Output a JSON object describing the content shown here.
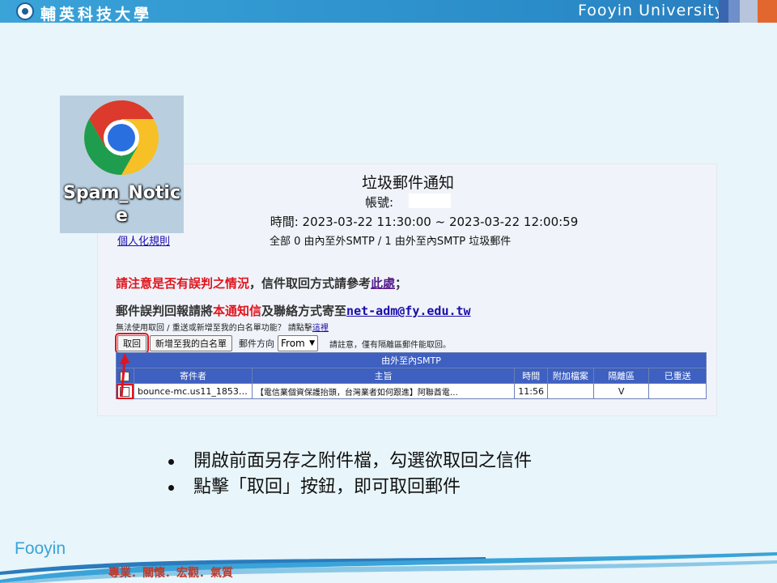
{
  "header": {
    "cn_name": "輔英科技大學",
    "en_name": "Fooyin University"
  },
  "chrome_tile": {
    "label_line1": "Spam_Notic",
    "label_line2": "e",
    "icon": "chrome-icon"
  },
  "mail": {
    "title": "垃圾郵件通知",
    "account_label": "帳號:",
    "time_line": "時間: 2023-03-22 11:30:00 ~ 2023-03-22 12:00:59",
    "rule_link": "個人化規則",
    "summary": "全部  0 由內至外SMTP / 1 由外至內SMTP  垃圾郵件",
    "notice1_red": "請注意是否有誤判之情況",
    "notice1_mid": "，信件取回方式請參考",
    "notice1_link": "此處",
    "notice1_end": "；",
    "notice2_start": "郵件誤判回報請將",
    "notice2_red": "本通知信",
    "notice2_mid": "及聯絡方式寄至",
    "notice2_email": "net-adm@fy.edu.tw",
    "notice3_text": "無法使用取回 / 重送或新增至我的白名單功能？ 請點擊",
    "notice3_link": "這裡",
    "toolbar": {
      "retrieve_button": "取回",
      "whitelist_button": "新增至我的白名單",
      "direction_label": "郵件方向",
      "direction_value": "From",
      "note": "請註意，僅有隔離區郵件能取回。"
    },
    "table": {
      "group_header": "由外至內SMTP",
      "columns": [
        "寄件者",
        "主旨",
        "時間",
        "附加檔案",
        "隔離區",
        "已重送"
      ],
      "rows": [
        {
          "sender": "bounce-mc.us11_1853…",
          "subject": "【電信業個資保護抬頭，台灣業者如何跟進】阿聯酋電…",
          "time": "11:56",
          "attachment": "",
          "quarantine": "V",
          "resent": ""
        }
      ]
    }
  },
  "bullets": [
    "開啟前面另存之附件檔，勾選欲取回之信件",
    "點擊「取回」按鈕，即可取回郵件"
  ],
  "footer": {
    "word": "Fooyin",
    "motto": "專業．關懷．宏觀．氣質"
  },
  "colors": {
    "header_blue": "#2a8cc8",
    "table_header": "#3e60c0",
    "highlight_red": "#e0141e"
  }
}
